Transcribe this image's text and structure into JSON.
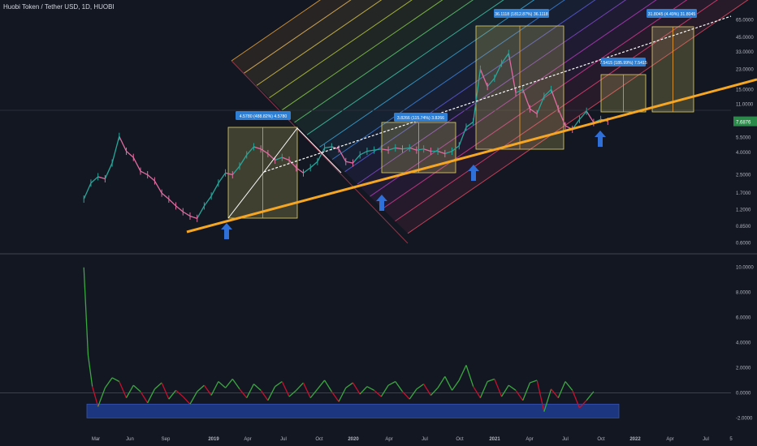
{
  "header": {
    "symbol_title": "Huobi Token / Tether USD, 1D, HUOBI"
  },
  "colors": {
    "background": "#131722",
    "axis_text": "#b2b5be",
    "price_up": "#26a69a",
    "price_down": "#e06ba0",
    "trendline": "#f5a623",
    "projection_box": "#e4d46a",
    "label_bg": "#2e7fd4",
    "arrow": "#2f6fd8",
    "oscillator_line_up": "#3aa840",
    "oscillator_line_down": "#c8102e",
    "oscillator_band": "#1e3a8a",
    "current_price_bg": "#2b8a4a"
  },
  "time_axis": {
    "labels": [
      "Mar",
      "Jun",
      "Sep",
      "2019",
      "Apr",
      "Jul",
      "Oct",
      "2020",
      "Apr",
      "Jul",
      "Oct",
      "2021",
      "Apr",
      "Jul",
      "Oct",
      "2022",
      "Apr",
      "Jul",
      "5"
    ]
  },
  "chart_data": [
    {
      "type": "line",
      "name": "price-panel",
      "scale": "log",
      "y_ticks": [
        "65.0000",
        "45.0000",
        "33.0000",
        "23.0000",
        "15.0000",
        "11.0000",
        "7.6876",
        "5.5000",
        "4.0000",
        "2.5000",
        "1.7000",
        "1.2000",
        "0.8500",
        "0.6000"
      ],
      "y_tick_values": [
        65,
        45,
        33,
        23,
        15,
        11,
        7.6876,
        5.5,
        4,
        2.5,
        1.7,
        1.2,
        0.85,
        0.6
      ],
      "ylim": [
        0.5,
        70
      ],
      "current_price": "7.6876",
      "x": [
        2018.15,
        2018.2,
        2018.25,
        2018.3,
        2018.35,
        2018.4,
        2018.45,
        2018.5,
        2018.55,
        2018.6,
        2018.65,
        2018.7,
        2018.75,
        2018.8,
        2018.85,
        2018.9,
        2018.95,
        2019.0,
        2019.05,
        2019.1,
        2019.15,
        2019.2,
        2019.25,
        2019.3,
        2019.35,
        2019.4,
        2019.45,
        2019.5,
        2019.55,
        2019.6,
        2019.65,
        2019.7,
        2019.75,
        2019.8,
        2019.85,
        2019.9,
        2019.95,
        2020.0,
        2020.05,
        2020.1,
        2020.15,
        2020.2,
        2020.25,
        2020.3,
        2020.35,
        2020.4,
        2020.45,
        2020.5,
        2020.55,
        2020.6,
        2020.65,
        2020.7,
        2020.75,
        2020.8,
        2020.85,
        2020.9,
        2020.95,
        2021.0,
        2021.05,
        2021.1,
        2021.15,
        2021.2,
        2021.25,
        2021.3,
        2021.35,
        2021.4,
        2021.45,
        2021.5,
        2021.55,
        2021.6,
        2021.65,
        2021.7,
        2021.75,
        2021.8,
        2021.85
      ],
      "values": [
        1.5,
        2.1,
        2.4,
        2.3,
        3.2,
        5.6,
        4.1,
        3.6,
        2.7,
        2.5,
        2.2,
        1.7,
        1.5,
        1.3,
        1.15,
        1.05,
        1.0,
        1.3,
        1.6,
        2.1,
        2.6,
        2.5,
        3.0,
        3.8,
        4.5,
        4.3,
        3.9,
        3.4,
        3.6,
        3.4,
        2.9,
        2.6,
        2.9,
        3.3,
        4.4,
        4.5,
        4.3,
        3.3,
        3.2,
        3.8,
        4.1,
        4.2,
        4.3,
        4.2,
        4.4,
        4.3,
        4.4,
        4.2,
        4.3,
        4.1,
        4.1,
        3.9,
        4.1,
        4.6,
        6.8,
        7.6,
        23.0,
        16.0,
        19.0,
        26.0,
        32.0,
        14.0,
        15.0,
        10.0,
        9.0,
        13.0,
        15.0,
        10.0,
        7.0,
        6.5,
        8.0,
        9.5,
        7.5,
        8.0,
        7.7
      ]
    },
    {
      "type": "line",
      "name": "oscillator-panel",
      "y_ticks": [
        "10.0000",
        "8.0000",
        "6.0000",
        "4.0000",
        "2.0000",
        "0.0000",
        "-2.0000"
      ],
      "y_tick_values": [
        10,
        8,
        6,
        4,
        2,
        0,
        -2
      ],
      "ylim": [
        -2.3,
        10.5
      ],
      "x": [
        2018.15,
        2018.18,
        2018.21,
        2018.25,
        2018.3,
        2018.35,
        2018.4,
        2018.45,
        2018.5,
        2018.55,
        2018.6,
        2018.65,
        2018.7,
        2018.75,
        2018.8,
        2018.85,
        2018.9,
        2018.95,
        2019.0,
        2019.05,
        2019.1,
        2019.15,
        2019.2,
        2019.25,
        2019.3,
        2019.35,
        2019.4,
        2019.45,
        2019.5,
        2019.55,
        2019.6,
        2019.65,
        2019.7,
        2019.75,
        2019.8,
        2019.85,
        2019.9,
        2019.95,
        2020.0,
        2020.05,
        2020.1,
        2020.15,
        2020.2,
        2020.25,
        2020.3,
        2020.35,
        2020.4,
        2020.45,
        2020.5,
        2020.55,
        2020.6,
        2020.65,
        2020.7,
        2020.75,
        2020.8,
        2020.85,
        2020.9,
        2020.95,
        2021.0,
        2021.05,
        2021.1,
        2021.15,
        2021.2,
        2021.25,
        2021.3,
        2021.35,
        2021.4,
        2021.45,
        2021.5,
        2021.55,
        2021.6,
        2021.65,
        2021.7,
        2021.75
      ],
      "values": [
        10.0,
        3.0,
        0.5,
        -1.1,
        0.4,
        1.2,
        0.9,
        -0.4,
        0.6,
        0.1,
        -0.8,
        0.3,
        0.8,
        -0.5,
        0.2,
        -0.3,
        -0.9,
        0.1,
        0.6,
        -0.2,
        0.9,
        0.4,
        1.1,
        0.3,
        -0.4,
        0.7,
        0.2,
        -0.6,
        0.5,
        0.9,
        -0.3,
        0.2,
        0.8,
        -0.4,
        0.3,
        1.0,
        0.1,
        -0.7,
        0.4,
        0.8,
        -0.1,
        0.5,
        0.2,
        -0.3,
        0.6,
        0.9,
        0.1,
        -0.5,
        0.3,
        0.7,
        -0.2,
        0.4,
        1.3,
        0.2,
        1.0,
        2.2,
        0.5,
        -0.4,
        0.9,
        1.1,
        -0.3,
        0.6,
        0.2,
        -0.6,
        0.8,
        1.0,
        -1.5,
        0.3,
        -0.4,
        0.9,
        0.2,
        -1.2,
        -0.6,
        0.1
      ]
    }
  ],
  "annotations": {
    "projection_labels": [
      "4.5780 (488.82%) 4.5780",
      "3.8266 (115.74%) 3.8266",
      "36.1118 (1812.87%) 36.1118",
      "7.5415 (185.99%) 7.5415",
      "31.8045 (4.49%) 31.8045"
    ]
  }
}
